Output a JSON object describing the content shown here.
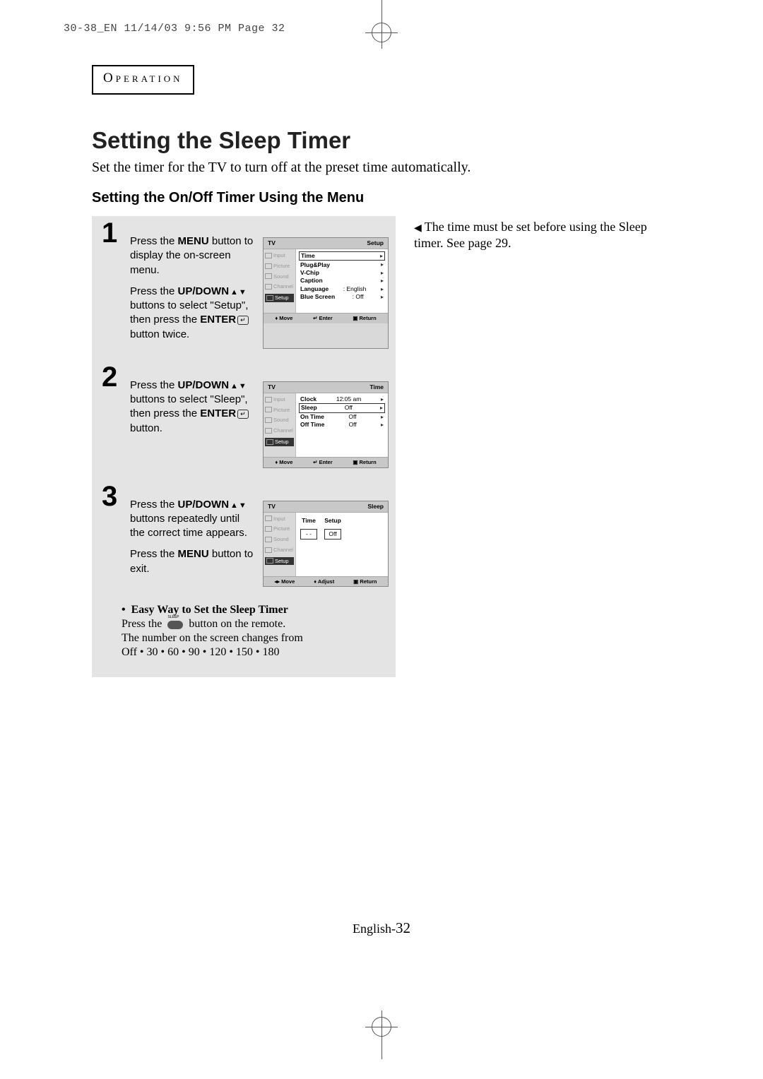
{
  "print_header": "30-38_EN  11/14/03 9:56 PM  Page 32",
  "section_label": "Operation",
  "title": "Setting the Sleep Timer",
  "intro": "Set the timer for the TV to turn off at the preset time automatically.",
  "subheading": "Setting the On/Off  Timer Using the Menu",
  "sidenote": "The time must be set before using the Sleep timer. See page 29.",
  "steps": {
    "s1": {
      "num": "1",
      "p1a": "Press the ",
      "p1b": "MENU",
      "p1c": " button to display the on-screen menu.",
      "p2a": "Press the ",
      "p2b": "UP/DOWN",
      "p2c": " buttons to select \"Setup\", then press the ",
      "p2d": "ENTER",
      "p2e": " button twice."
    },
    "s2": {
      "num": "2",
      "p1a": "Press the ",
      "p1b": "UP/DOWN",
      "p1c": " buttons to select \"Sleep\", then press the ",
      "p1d": "ENTER",
      "p1e": " button."
    },
    "s3": {
      "num": "3",
      "p1a": "Press the ",
      "p1b": "UP/DOWN",
      "p1c": " buttons repeatedly until the correct time appears.",
      "p2a": "Press the ",
      "p2b": "MENU",
      "p2c": " button to exit."
    }
  },
  "osd_side": {
    "input": "Input",
    "picture": "Picture",
    "sound": "Sound",
    "channel": "Channel",
    "setup": "Setup"
  },
  "osd1": {
    "hdr_l": "TV",
    "hdr_r": "Setup",
    "rows": {
      "time": "Time",
      "plugplay": "Plug&Play",
      "vchip": "V-Chip",
      "caption": "Caption",
      "language": "Language",
      "language_v": ": English",
      "bluescreen": "Blue Screen",
      "bluescreen_v": ": Off"
    },
    "ftr": {
      "move": "Move",
      "enter": "Enter",
      "return": "Return"
    }
  },
  "osd2": {
    "hdr_l": "TV",
    "hdr_r": "Time",
    "rows": {
      "clock": "Clock",
      "clock_v": "12:05 am",
      "sleep": "Sleep",
      "sleep_v": "Off",
      "ontime": "On Time",
      "ontime_v": "Off",
      "offtime": "Off Time",
      "offtime_v": "Off"
    },
    "ftr": {
      "move": "Move",
      "enter": "Enter",
      "return": "Return"
    }
  },
  "osd3": {
    "hdr_l": "TV",
    "hdr_r": "Sleep",
    "col1_l": "Time",
    "col1_v": "- -",
    "col2_l": "Setup",
    "col2_v": "Off",
    "ftr": {
      "move": "Move",
      "adjust": "Adjust",
      "return": "Return"
    }
  },
  "easy": {
    "hd": "Easy Way to Set the Sleep Timer",
    "l1a": "Press the ",
    "l1b": " button on the remote.",
    "l2": "The number on the screen changes from",
    "l3": "Off • 30 • 60 • 90 • 120 • 150 • 180"
  },
  "pagefoot_a": "English-",
  "pagefoot_b": "32",
  "icons": {
    "updown": "▲▼",
    "leftptr": "◀",
    "arw": "▸",
    "enter_key": "↵",
    "menu_key": "☰"
  }
}
